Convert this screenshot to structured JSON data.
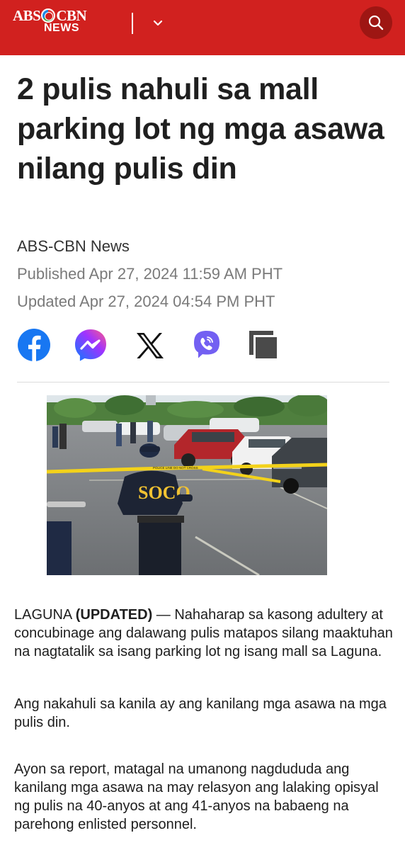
{
  "header": {
    "logo_top": "ABS",
    "logo_top2": "CBN",
    "logo_bottom": "NEWS",
    "brand_color": "#d1211f",
    "menu_icon": "chevron-down-icon",
    "search_icon": "search-icon"
  },
  "article": {
    "title": "2 pulis nahuli sa mall parking lot ng mga asawa nilang pulis din",
    "author": "ABS-CBN News",
    "published": "Published Apr 27, 2024 11:59 AM PHT",
    "updated": "Updated Apr 27, 2024 04:54 PM PHT",
    "share": [
      "facebook-icon",
      "messenger-icon",
      "x-icon",
      "viber-icon",
      "copy-icon"
    ],
    "paragraphs": {
      "p1_location": "LAGUNA",
      "p1_tag": "(UPDATED)",
      "p1_text": " — Nahaharap sa kasong adultery at concubinage ang dalawang pulis matapos silang maaktuhan na nagtatalik sa isang parking lot ng isang mall sa Laguna.",
      "p2": "Ang nakahuli sa kanila ay ang kanilang mga asawa na mga pulis din.",
      "p3": "Ayon sa report, matagal na umanong nagdududa ang kanilang mga asawa na may relasyon ang lalaking opisyal ng pulis na 40-anyos at ang 41-anyos na babaeng na parehong enlisted personnel."
    },
    "photo_vest_text": "SOCO",
    "photo_tape_text": "POLICE LINE DO NOT CROSS"
  }
}
